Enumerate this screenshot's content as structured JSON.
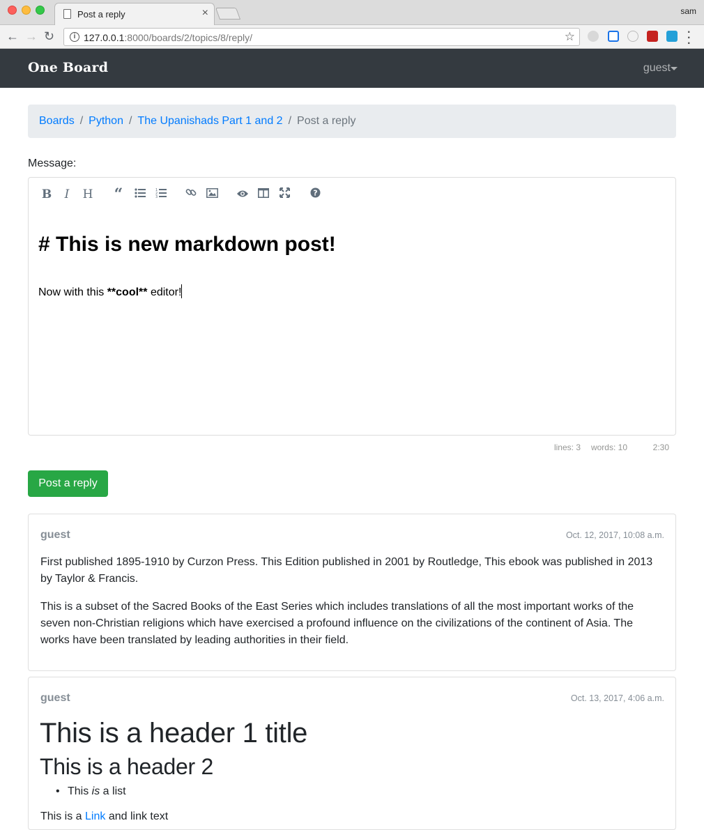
{
  "browser": {
    "tab_title": "Post a reply",
    "profile_name": "sam",
    "url_host": "127.0.0.1",
    "url_rest": ":8000/boards/2/topics/8/reply/"
  },
  "navbar": {
    "brand": "One Board",
    "user": "guest"
  },
  "breadcrumb": {
    "items": [
      "Boards",
      "Python",
      "The Upanishads Part 1 and 2"
    ],
    "active": "Post a reply",
    "separator": "/"
  },
  "form": {
    "message_label": "Message:",
    "editor": {
      "heading_line": "# This is new markdown post!",
      "line_prefix": "Now with this ",
      "line_bold": "**cool**",
      "line_suffix": " editor!"
    },
    "status": {
      "lines_label": "lines:",
      "lines": "3",
      "words_label": "words:",
      "words": "10",
      "cursor": "2:30"
    },
    "submit_label": "Post a reply"
  },
  "toolbar_icons": [
    "bold-icon",
    "italic-icon",
    "heading-icon",
    "quote-icon",
    "unordered-list-icon",
    "ordered-list-icon",
    "link-icon",
    "image-icon",
    "preview-icon",
    "side-by-side-icon",
    "fullscreen-icon",
    "guide-icon"
  ],
  "posts": [
    {
      "author": "guest",
      "date": "Oct. 12, 2017, 10:08 a.m.",
      "paragraphs": [
        "First published 1895-1910 by Curzon Press. This Edition published in 2001 by Routledge, This ebook was published in 2013 by Taylor & Francis.",
        "This is a subset of the Sacred Books of the East Series which includes translations of all the most important works of the seven non-Christian religions which have exercised a profound influence on the civilizations of the continent of Asia. The works have been translated by leading authorities in their field."
      ]
    },
    {
      "author": "guest",
      "date": "Oct. 13, 2017, 4:06 a.m.",
      "h1": "This is a header 1 title",
      "h2": "This is a header 2",
      "list_item_a": "This ",
      "list_item_em": "is",
      "list_item_b": " a list",
      "para_prefix": "This is a ",
      "para_link": "Link",
      "para_suffix": " and link text"
    }
  ],
  "colors": {
    "navbar_bg": "#343a40",
    "link": "#007bff",
    "success": "#28a745",
    "muted": "#868e96"
  }
}
